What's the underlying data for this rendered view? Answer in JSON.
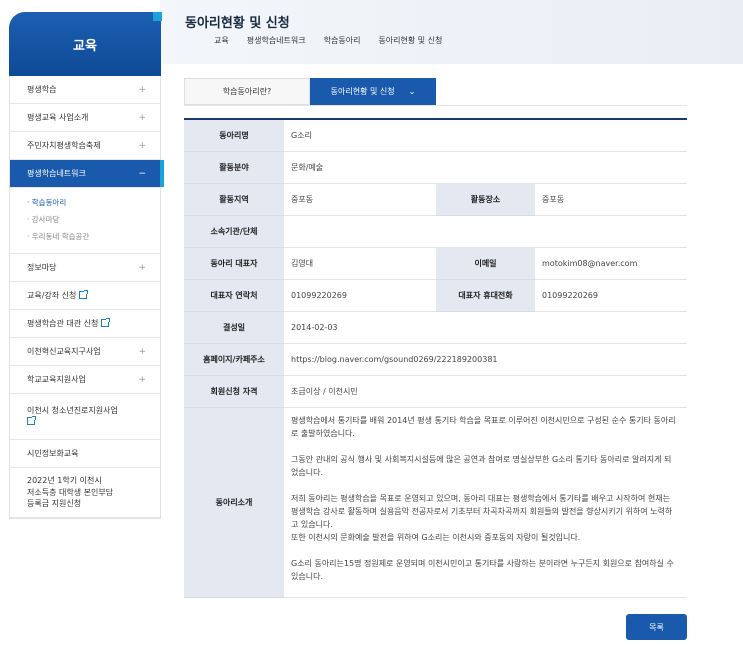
{
  "header": {
    "title": "동아리현황 및 신청",
    "breadcrumb": [
      "교육",
      "평생학습네트워크",
      "학습동아리",
      "동아리현황 및 신청"
    ]
  },
  "sidebar": {
    "title": "교육",
    "items": [
      {
        "label": "평생학습",
        "expand": "+"
      },
      {
        "label": "평생교육 사업소개",
        "expand": "+"
      },
      {
        "label": "주민자치평생학습축제",
        "expand": "+"
      },
      {
        "label": "평생학습네트워크",
        "expand": "−"
      },
      {
        "label": "정보마당",
        "expand": "+"
      },
      {
        "label": "교육/강좌 신청"
      },
      {
        "label": "평생학습관 대관 신청"
      },
      {
        "label": "이천혁신교육지구사업",
        "expand": "+"
      },
      {
        "label": "학교교육지원사업",
        "expand": "+"
      },
      {
        "label": "이천시 청소년진로지원사업"
      },
      {
        "label": "시민정보화교육"
      },
      {
        "label_lines": [
          "2022년 1학기 이천시",
          "저소득층 대학생 본인부담",
          "등록금 지원신청"
        ]
      }
    ],
    "submenu": [
      "· 학습동아리",
      "· 강사마당",
      "· 우리동네 학습공간"
    ]
  },
  "tabs": {
    "tab1": "학습동아리란?",
    "tab2": "동아리현황 및 신청",
    "tab2_chevron": "⌄"
  },
  "club": {
    "name_label": "동아리명",
    "name": "G소리",
    "field_label": "활동분야",
    "field": "문화/예술",
    "area_label": "활동지역",
    "area": "중포동",
    "place_label": "활동장소",
    "place": "중포동",
    "org_label": "소속기관/단체",
    "org": "",
    "rep_label": "동아리 대표자",
    "rep": "김영대",
    "email_label": "이메일",
    "email": "motokim08@naver.com",
    "phone_label": "대표자 연락처",
    "phone": "01099220269",
    "mobile_label": "대표자 휴대전화",
    "mobile": "01099220269",
    "founded_label": "결성일",
    "founded": "2014-02-03",
    "homepage_label": "홈페이지/카페주소",
    "homepage": "https://blog.naver.com/gsound0269/222189200381",
    "qual_label": "회원신청 자격",
    "qual": "초급이상 / 이천시민",
    "intro_label": "동아리소개",
    "intro": [
      "평생학습에서 통기타를 배워 2014년 평생 통기타 학습을 목표로 이루어진 이천시민으로 구성된 순수 통기타 동아리로 출발하였습니다.",
      "그동안 관내의 공식 행사 및 사회복지시설등에 많은 공연과 참여로 명실상부한 G소리 통기타 동아리로 알려지게 되었습니다.",
      "저희 동아리는 평생학습을 목표로 운영되고 있으며, 동아리 대표는 평생학습에서 통기타를 배우고 시작하여 현재는 평생학습 강사로 활동하며 실용음악 전공자로서 기초부터 차곡차곡까지 회원들의 발전을 향상시키기 위하여 노력하고 있습니다.\n또한 이천시의 문화예술 발전을 위하여 G소리는 이천시와 중포동의 자랑이 될것입니다.",
      "G소리 동아리는15명 정원제로 운영되며 이천시민이고 통기타를 사랑하는 분이라면 누구든지 회원으로 참여하실 수 있습니다."
    ]
  },
  "list_button": "목록"
}
